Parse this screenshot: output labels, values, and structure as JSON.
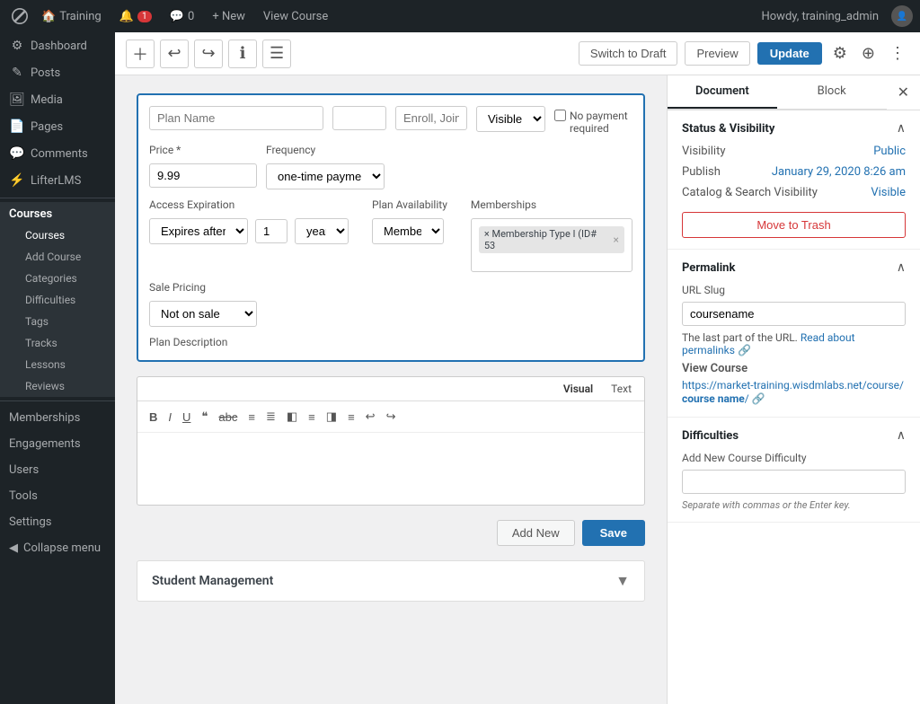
{
  "adminbar": {
    "site_name": "Training",
    "notifications": "1",
    "comments": "0",
    "new_label": "+ New",
    "view_course": "View Course",
    "greeting": "Howdy, training_admin"
  },
  "sidebar": {
    "dashboard_label": "Dashboard",
    "menu_items": [
      {
        "id": "posts",
        "label": "Posts",
        "icon": "✎"
      },
      {
        "id": "media",
        "label": "Media",
        "icon": "🖼"
      },
      {
        "id": "pages",
        "label": "Pages",
        "icon": "📄"
      },
      {
        "id": "comments",
        "label": "Comments",
        "icon": "💬"
      },
      {
        "id": "lifterLMS",
        "label": "LifterLMS",
        "icon": "⚡"
      }
    ],
    "courses_section": {
      "title": "Courses",
      "items": [
        {
          "id": "courses",
          "label": "Courses"
        },
        {
          "id": "add-course",
          "label": "Add Course"
        },
        {
          "id": "categories",
          "label": "Categories"
        },
        {
          "id": "difficulties",
          "label": "Difficulties"
        },
        {
          "id": "tags",
          "label": "Tags"
        },
        {
          "id": "tracks",
          "label": "Tracks"
        },
        {
          "id": "lessons",
          "label": "Lessons"
        },
        {
          "id": "reviews",
          "label": "Reviews"
        }
      ]
    },
    "memberships_label": "Memberships",
    "engagements_label": "Engagements",
    "users_label": "Users",
    "tools_label": "Tools",
    "settings_label": "Settings",
    "collapse_label": "Collapse menu"
  },
  "editor": {
    "switch_draft": "Switch to Draft",
    "preview": "Preview",
    "update": "Update"
  },
  "plan": {
    "name_placeholder": "Plan Name",
    "enroll_join": "Enroll, Join",
    "visible_label": "Visible",
    "no_payment_label": "No payment required",
    "price_label": "Price *",
    "price_value": "9.99",
    "frequency_label": "Frequency",
    "frequency_value": "one-time payme",
    "access_expiration_label": "Access Expiration",
    "expires_after": "Expires after",
    "expiry_number": "1",
    "expiry_unit": "year",
    "plan_availability_label": "Plan Availability",
    "plan_availability_value": "Member",
    "memberships_label": "Memberships",
    "membership_tag": "× Membership Type I (ID# 53",
    "sale_pricing_label": "Sale Pricing",
    "sale_pricing_value": "Not on sale",
    "plan_description_label": "Plan Description"
  },
  "text_editor": {
    "visual_tab": "Visual",
    "text_tab": "Text"
  },
  "plan_actions": {
    "add_new": "Add New",
    "save": "Save"
  },
  "student_management": {
    "title": "Student Management"
  },
  "right_sidebar": {
    "document_tab": "Document",
    "block_tab": "Block",
    "status_visibility_title": "Status & Visibility",
    "visibility_label": "Visibility",
    "visibility_value": "Public",
    "publish_label": "Publish",
    "publish_value": "January 29, 2020 8:26 am",
    "catalog_search_label": "Catalog & Search Visibility",
    "catalog_search_value": "Visible",
    "move_trash": "Move to Trash",
    "permalink_title": "Permalink",
    "url_slug_label": "URL Slug",
    "url_slug_value": "coursename",
    "permalink_desc_prefix": "The last part of the URL.",
    "read_about": "Read about permalinks",
    "view_course_label": "View Course",
    "view_course_url": "https://market-training.wisdmlabs.net/course/",
    "view_course_bold": "course name",
    "difficulties_title": "Difficulties",
    "difficulties_toggle": "^",
    "add_difficulty_label": "Add New Course Difficulty",
    "difficulty_placeholder": "",
    "difficulty_hint": "Separate with commas or the Enter key."
  }
}
